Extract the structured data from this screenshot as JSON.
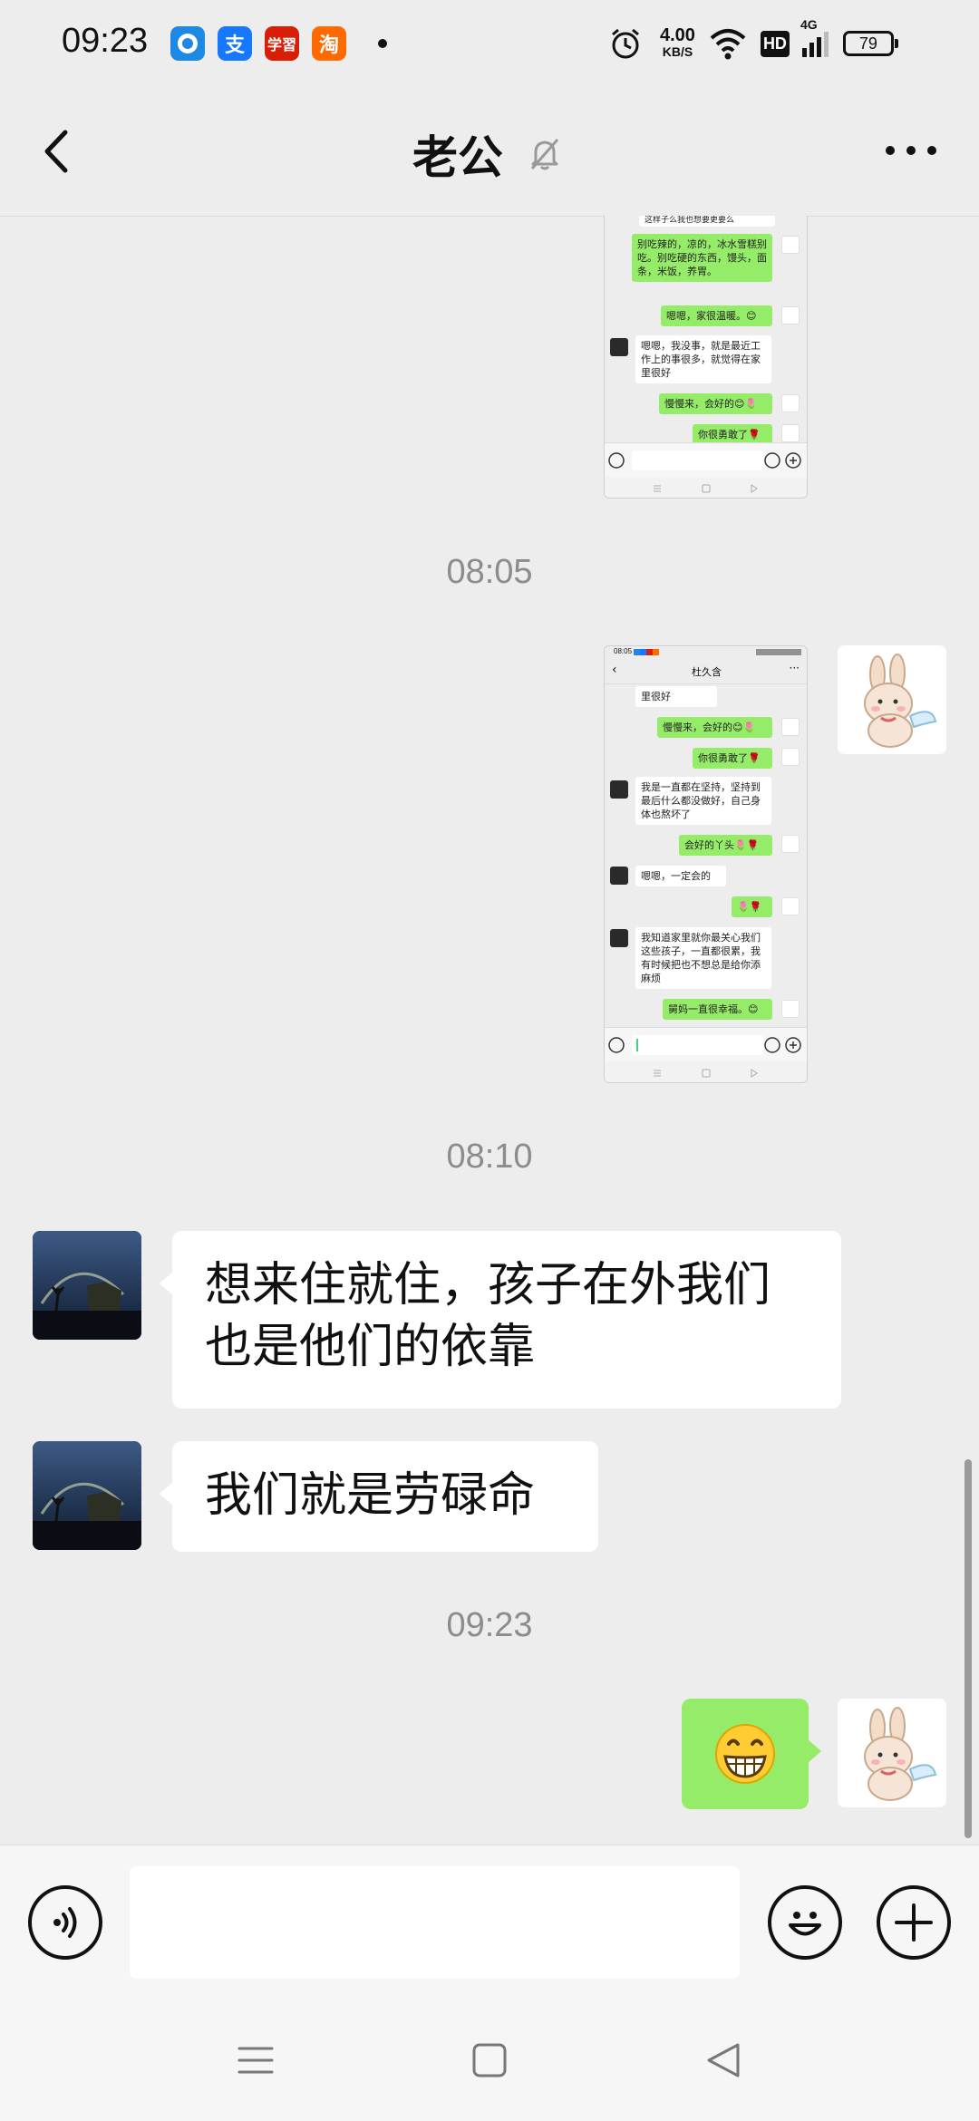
{
  "status_bar": {
    "time": "09:23",
    "apps": [
      {
        "name": "circle-app-icon",
        "glyph": "◉",
        "color": "#1e88e5"
      },
      {
        "name": "alipay-icon",
        "glyph": "支",
        "color": "#1677ff"
      },
      {
        "name": "xuexi-icon",
        "glyph": "学",
        "color": "#d81e06"
      },
      {
        "name": "taobao-icon",
        "glyph": "淘",
        "color": "#ff6a00"
      }
    ],
    "net_speed_value": "4.00",
    "net_speed_unit": "KB/S",
    "hd": "HD",
    "signal_type": "4G",
    "battery": "79"
  },
  "header": {
    "title": "老公",
    "back_icon": "chevron-left-icon",
    "mute_icon": "bell-off-icon",
    "more_icon": "more-dots-icon"
  },
  "chat": {
    "timestamps": [
      "08:05",
      "08:10",
      "09:23"
    ],
    "screenshot1": {
      "bubbles": [
        {
          "side": "right",
          "text": "别吃辣的，凉的，冰水雪糕别吃。别吃硬的东西，馒头，面条，米饭，养胃。"
        },
        {
          "side": "right",
          "text": "嗯嗯，家很温暖。😊"
        },
        {
          "side": "left",
          "text": "嗯嗯，我没事，就是最近工作上的事很多，就觉得在家里很好"
        },
        {
          "side": "right",
          "text": "慢慢来，会好的😊🌷"
        },
        {
          "side": "right",
          "text": "你很勇敢了🌹"
        }
      ]
    },
    "screenshot2": {
      "header_name": "杜久含",
      "status_time": "08:05",
      "bubbles": [
        {
          "side": "left",
          "text": "里很好"
        },
        {
          "side": "right",
          "text": "慢慢来，会好的😊🌷"
        },
        {
          "side": "right",
          "text": "你很勇敢了🌹"
        },
        {
          "side": "left",
          "text": "我是一直都在坚持，坚持到最后什么都没做好，自己身体也熬坏了"
        },
        {
          "side": "right",
          "text": "会好的丫头🌷🌹"
        },
        {
          "side": "left",
          "text": "嗯嗯，一定会的"
        },
        {
          "side": "right",
          "text": "🌷🌹"
        },
        {
          "side": "left",
          "text": "我知道家里就你最关心我们这些孩子，一直都很累，我有时候把也不想总是给你添麻烦"
        },
        {
          "side": "right",
          "text": "舅妈一直很幸福。😊"
        }
      ]
    },
    "messages": [
      {
        "side": "left",
        "text_line1": "想来住就住，孩子在外我们",
        "text_line2": "也是他们的依靠"
      },
      {
        "side": "left",
        "text": "我们就是劳碌命"
      },
      {
        "side": "right",
        "emoji": "😁"
      }
    ]
  },
  "input_bar": {
    "voice_icon": "voice-icon",
    "emoji_icon": "emoji-icon",
    "plus_icon": "plus-icon",
    "placeholder": ""
  },
  "nav": {
    "menu_icon": "menu-icon",
    "home_icon": "home-icon",
    "back_icon": "back-triangle-icon"
  }
}
